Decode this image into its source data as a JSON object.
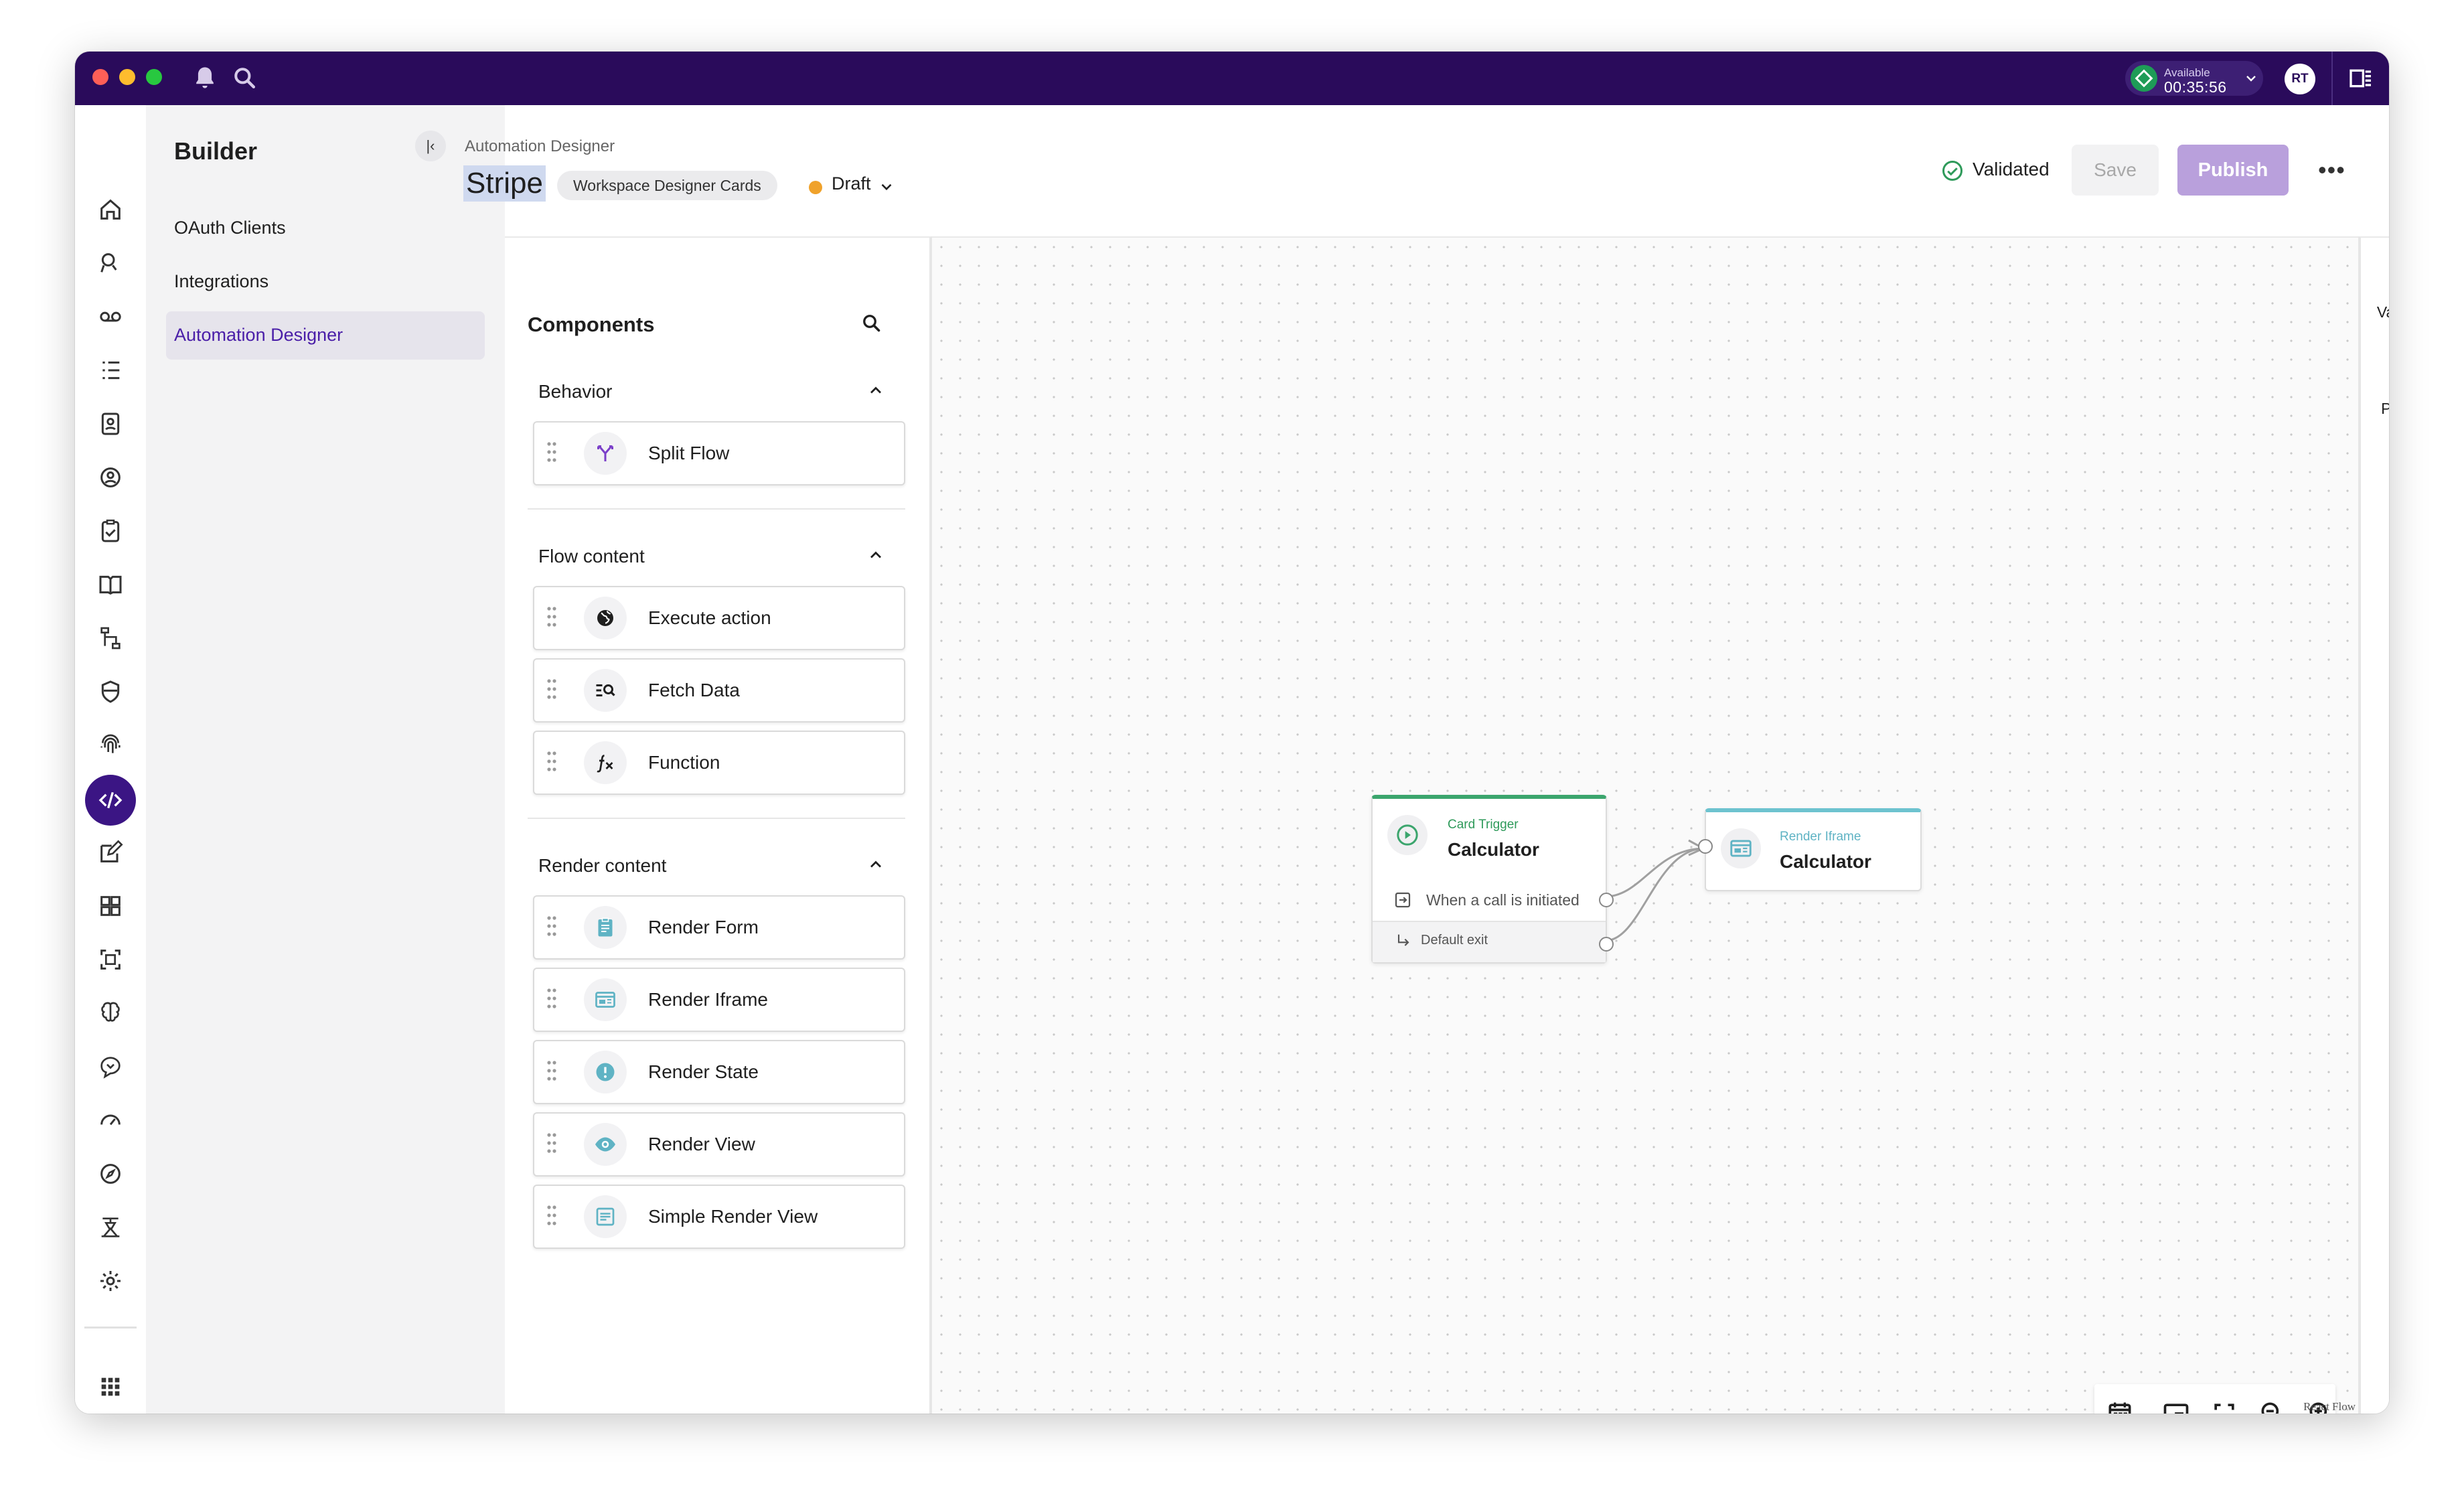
{
  "titlebar": {
    "status_label": "Available",
    "status_time": "00:35:56",
    "avatar_initials": "RT"
  },
  "builder": {
    "title": "Builder",
    "items": [
      {
        "label": "OAuth Clients",
        "selected": false
      },
      {
        "label": "Integrations",
        "selected": false
      },
      {
        "label": "Automation Designer",
        "selected": true
      }
    ]
  },
  "header": {
    "breadcrumb": "Automation Designer",
    "title": "Stripe",
    "tag": "Workspace Designer Cards",
    "status": "Draft",
    "validated": "Validated",
    "save_label": "Save",
    "publish_label": "Publish",
    "more": "•••"
  },
  "components": {
    "title": "Components",
    "sections": [
      {
        "title": "Behavior",
        "items": [
          "Split Flow"
        ]
      },
      {
        "title": "Flow content",
        "items": [
          "Execute action",
          "Fetch Data",
          "Function"
        ]
      },
      {
        "title": "Render content",
        "items": [
          "Render Form",
          "Render Iframe",
          "Render State",
          "Render View",
          "Simple Render View"
        ]
      }
    ]
  },
  "canvas": {
    "trigger_node": {
      "kind": "Card Trigger",
      "name": "Calculator",
      "event": "When a call is initiated",
      "exit": "Default exit"
    },
    "iframe_node": {
      "kind": "Render Iframe",
      "name": "Calculator"
    },
    "attribution": "React Flow"
  },
  "right_panel": {
    "variables_label": "Variables",
    "variables_icon": "{}",
    "preview_label": "Preview"
  },
  "colors": {
    "titlebar": "#2a0b5b",
    "accent": "#4a1ea8",
    "publish": "#b9a0dc",
    "trigger": "#3ba56d",
    "iframe": "#6dc3cf",
    "draft": "#f0a22b"
  }
}
